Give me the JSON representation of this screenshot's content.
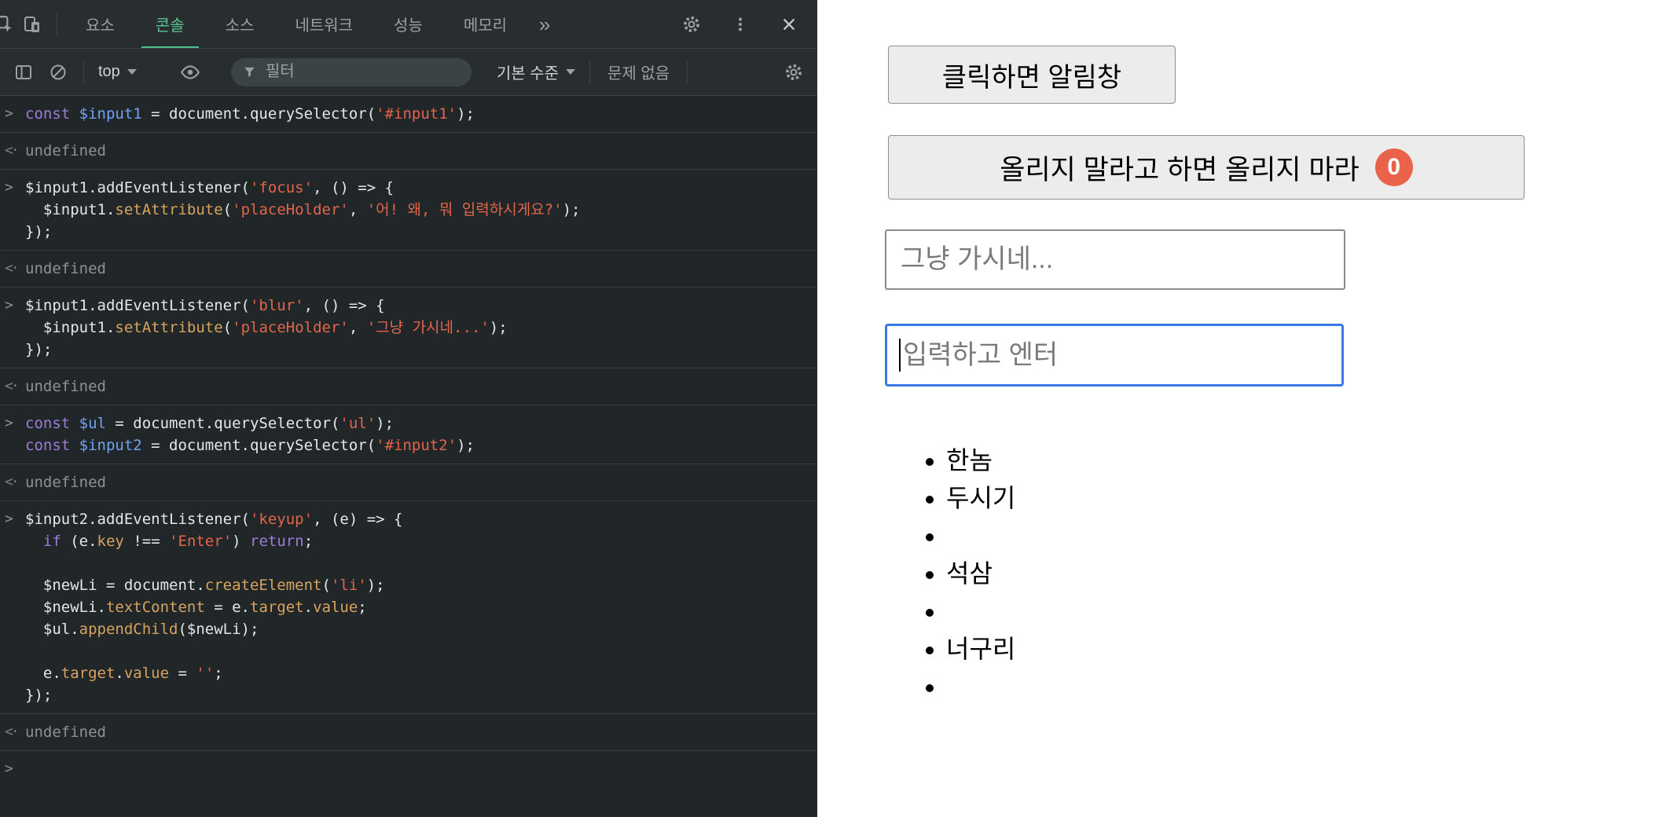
{
  "colors": {
    "devtools_accent_green": "#4fbf8f",
    "badge_red": "#ea6249",
    "focus_blue": "#3b78e7",
    "keyword_purple": "#9d7cd8",
    "string_orange": "#e4644a",
    "property_gold": "#d8a35e",
    "variable_blue": "#71a1f1"
  },
  "devtools": {
    "tabs": [
      {
        "id": "elements",
        "label": "요소",
        "active": false
      },
      {
        "id": "console",
        "label": "콘솔",
        "active": true
      },
      {
        "id": "sources",
        "label": "소스",
        "active": false
      },
      {
        "id": "network",
        "label": "네트워크",
        "active": false
      },
      {
        "id": "performance",
        "label": "성능",
        "active": false
      },
      {
        "id": "memory",
        "label": "메모리",
        "active": false
      }
    ],
    "more_tabs_glyph": "»",
    "toolbar": {
      "context_selector": "top",
      "filter_placeholder": "필터",
      "levels_label": "기본 수준",
      "issues_label": "문제 없음"
    },
    "console": {
      "input_marker": ">",
      "result_marker": "<·",
      "entries": [
        {
          "type": "input",
          "lines": [
            [
              {
                "c": "kw",
                "t": "const "
              },
              {
                "c": "def",
                "t": "$input1"
              },
              {
                "c": "pl",
                "t": " = document.querySelector("
              },
              {
                "c": "str",
                "t": "'#input1'"
              },
              {
                "c": "pl",
                "t": ");"
              }
            ]
          ]
        },
        {
          "type": "result",
          "lines": [
            [
              {
                "c": "gray",
                "t": "undefined"
              }
            ]
          ]
        },
        {
          "type": "input",
          "lines": [
            [
              {
                "c": "pl",
                "t": "$input1.addEventListener("
              },
              {
                "c": "str",
                "t": "'focus'"
              },
              {
                "c": "pl",
                "t": ", () => {"
              }
            ],
            [
              {
                "c": "pl",
                "t": "  $input1."
              },
              {
                "c": "prop",
                "t": "setAttribute"
              },
              {
                "c": "pl",
                "t": "("
              },
              {
                "c": "str",
                "t": "'placeHolder'"
              },
              {
                "c": "pl",
                "t": ", "
              },
              {
                "c": "str",
                "t": "'어! 왜, 뭐 입력하시게요?'"
              },
              {
                "c": "pl",
                "t": ");"
              }
            ],
            [
              {
                "c": "pl",
                "t": "});"
              }
            ]
          ]
        },
        {
          "type": "result",
          "lines": [
            [
              {
                "c": "gray",
                "t": "undefined"
              }
            ]
          ]
        },
        {
          "type": "input",
          "lines": [
            [
              {
                "c": "pl",
                "t": "$input1.addEventListener("
              },
              {
                "c": "str",
                "t": "'blur'"
              },
              {
                "c": "pl",
                "t": ", () => {"
              }
            ],
            [
              {
                "c": "pl",
                "t": "  $input1."
              },
              {
                "c": "prop",
                "t": "setAttribute"
              },
              {
                "c": "pl",
                "t": "("
              },
              {
                "c": "str",
                "t": "'placeHolder'"
              },
              {
                "c": "pl",
                "t": ", "
              },
              {
                "c": "str",
                "t": "'그냥 가시네...'"
              },
              {
                "c": "pl",
                "t": ");"
              }
            ],
            [
              {
                "c": "pl",
                "t": "});"
              }
            ]
          ]
        },
        {
          "type": "result",
          "lines": [
            [
              {
                "c": "gray",
                "t": "undefined"
              }
            ]
          ]
        },
        {
          "type": "input",
          "lines": [
            [
              {
                "c": "kw",
                "t": "const "
              },
              {
                "c": "def",
                "t": "$ul"
              },
              {
                "c": "pl",
                "t": " = document.querySelector("
              },
              {
                "c": "str",
                "t": "'ul'"
              },
              {
                "c": "pl",
                "t": ");"
              }
            ],
            [
              {
                "c": "kw",
                "t": "const "
              },
              {
                "c": "def",
                "t": "$input2"
              },
              {
                "c": "pl",
                "t": " = document.querySelector("
              },
              {
                "c": "str",
                "t": "'#input2'"
              },
              {
                "c": "pl",
                "t": ");"
              }
            ]
          ]
        },
        {
          "type": "result",
          "lines": [
            [
              {
                "c": "gray",
                "t": "undefined"
              }
            ]
          ]
        },
        {
          "type": "input",
          "lines": [
            [
              {
                "c": "pl",
                "t": "$input2.addEventListener("
              },
              {
                "c": "str",
                "t": "'keyup'"
              },
              {
                "c": "pl",
                "t": ", (e) => {"
              }
            ],
            [
              {
                "c": "pl",
                "t": "  "
              },
              {
                "c": "kw",
                "t": "if"
              },
              {
                "c": "pl",
                "t": " (e."
              },
              {
                "c": "prop",
                "t": "key"
              },
              {
                "c": "pl",
                "t": " !== "
              },
              {
                "c": "str",
                "t": "'Enter'"
              },
              {
                "c": "pl",
                "t": ") "
              },
              {
                "c": "kw",
                "t": "return"
              },
              {
                "c": "pl",
                "t": ";"
              }
            ],
            [],
            [
              {
                "c": "pl",
                "t": "  $newLi = document."
              },
              {
                "c": "prop",
                "t": "createElement"
              },
              {
                "c": "pl",
                "t": "("
              },
              {
                "c": "str",
                "t": "'li'"
              },
              {
                "c": "pl",
                "t": ");"
              }
            ],
            [
              {
                "c": "pl",
                "t": "  $newLi."
              },
              {
                "c": "prop",
                "t": "textContent"
              },
              {
                "c": "pl",
                "t": " = e."
              },
              {
                "c": "prop",
                "t": "target"
              },
              {
                "c": "pl",
                "t": "."
              },
              {
                "c": "prop",
                "t": "value"
              },
              {
                "c": "pl",
                "t": ";"
              }
            ],
            [
              {
                "c": "pl",
                "t": "  $ul."
              },
              {
                "c": "prop",
                "t": "appendChild"
              },
              {
                "c": "pl",
                "t": "($newLi);"
              }
            ],
            [],
            [
              {
                "c": "pl",
                "t": "  e."
              },
              {
                "c": "prop",
                "t": "target"
              },
              {
                "c": "pl",
                "t": "."
              },
              {
                "c": "prop",
                "t": "value"
              },
              {
                "c": "pl",
                "t": " = "
              },
              {
                "c": "str",
                "t": "''"
              },
              {
                "c": "pl",
                "t": ";"
              }
            ],
            [
              {
                "c": "pl",
                "t": "});"
              }
            ]
          ]
        },
        {
          "type": "result",
          "lines": [
            [
              {
                "c": "gray",
                "t": "undefined"
              }
            ]
          ]
        },
        {
          "type": "prompt",
          "lines": [
            []
          ]
        }
      ]
    }
  },
  "page": {
    "alert_button_label": "클릭하면 알림창",
    "counter_button_label": "올리지 말라고 하면 올리지 마라",
    "counter_badge": "0",
    "input1_placeholder": "그냥 가시네...",
    "input2_placeholder": "입력하고 엔터",
    "list_items": [
      "한놈",
      "두시기",
      "",
      "석삼",
      "",
      "너구리",
      ""
    ]
  }
}
